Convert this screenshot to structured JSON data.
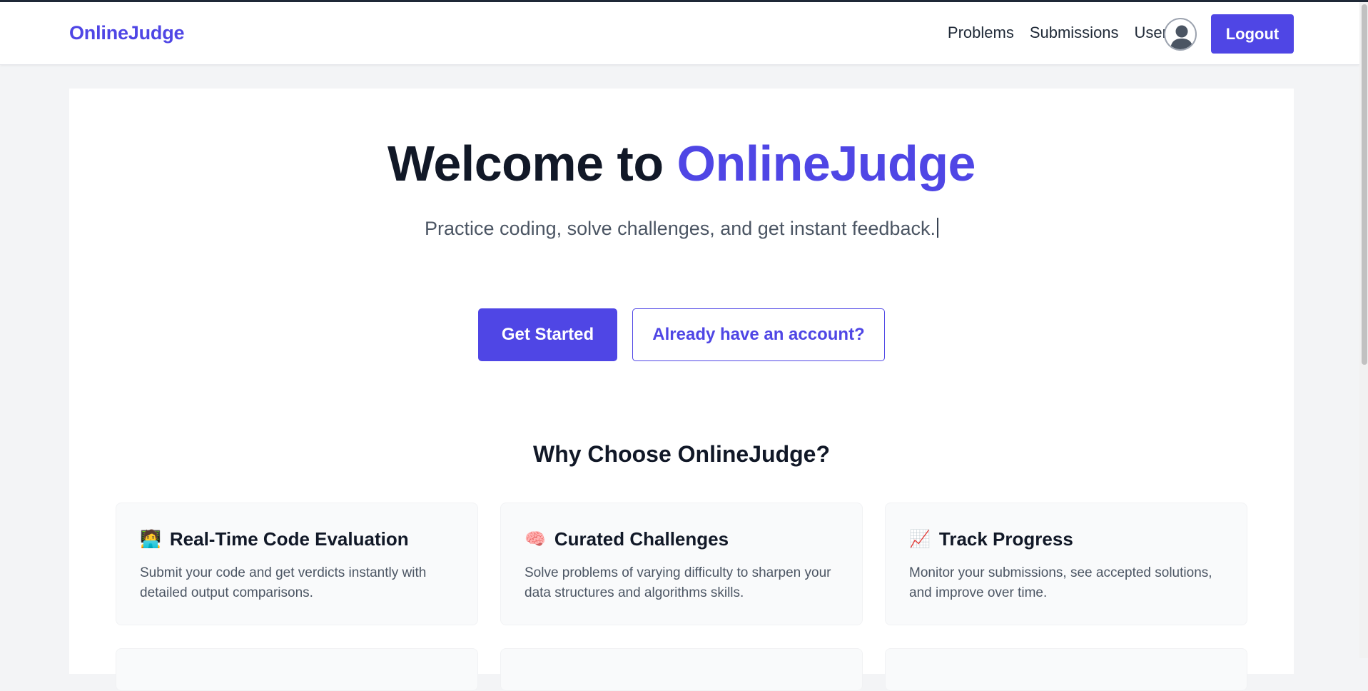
{
  "brand": "OnlineJudge",
  "nav": {
    "links": [
      "Problems",
      "Submissions",
      "Users"
    ],
    "logout_label": "Logout",
    "avatar_icon": "user-avatar-icon"
  },
  "hero": {
    "title_prefix": "Welcome to ",
    "title_accent": "OnlineJudge",
    "subtitle": "Practice coding, solve challenges, and get instant feedback.",
    "primary_button": "Get Started",
    "secondary_button": "Already have an account?"
  },
  "features": {
    "heading": "Why Choose OnlineJudge?",
    "items": [
      {
        "icon": "🧑‍💻",
        "icon_name": "coder-icon",
        "title": "Real-Time Code Evaluation",
        "description": "Submit your code and get verdicts instantly with detailed output comparisons."
      },
      {
        "icon": "🧠",
        "icon_name": "brain-icon",
        "title": "Curated Challenges",
        "description": "Solve problems of varying difficulty to sharpen your data structures and algorithms skills."
      },
      {
        "icon": "📈",
        "icon_name": "chart-increasing-icon",
        "title": "Track Progress",
        "description": "Monitor your submissions, see accepted solutions, and improve over time."
      }
    ]
  },
  "colors": {
    "accent": "#4f46e5",
    "background": "#f3f4f6",
    "card": "#ffffff",
    "feature_card": "#f9fafb",
    "text_primary": "#111827",
    "text_secondary": "#4b5563"
  }
}
